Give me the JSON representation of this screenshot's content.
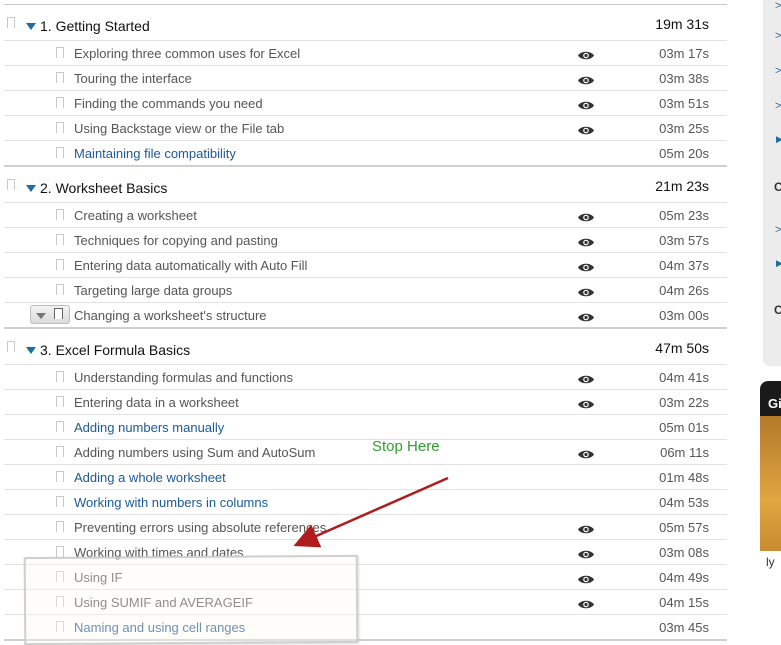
{
  "chapters": [
    {
      "title": "1. Getting Started",
      "duration": "19m 31s",
      "lessons": [
        {
          "title": "Exploring three common uses for Excel",
          "duration": "03m 17s",
          "viewed": true,
          "link": false
        },
        {
          "title": "Touring the interface",
          "duration": "03m 38s",
          "viewed": true,
          "link": false
        },
        {
          "title": "Finding the commands you need",
          "duration": "03m 51s",
          "viewed": true,
          "link": false
        },
        {
          "title": "Using Backstage view or the File tab",
          "duration": "03m 25s",
          "viewed": true,
          "link": false
        },
        {
          "title": "Maintaining file compatibility",
          "duration": "05m 20s",
          "viewed": false,
          "link": true
        }
      ]
    },
    {
      "title": "2. Worksheet Basics",
      "duration": "21m 23s",
      "lessons": [
        {
          "title": "Creating a worksheet",
          "duration": "05m 23s",
          "viewed": true,
          "link": false
        },
        {
          "title": "Techniques for copying and pasting",
          "duration": "03m 57s",
          "viewed": true,
          "link": false
        },
        {
          "title": "Entering data automatically with Auto Fill",
          "duration": "04m 37s",
          "viewed": true,
          "link": false
        },
        {
          "title": "Targeting large data groups",
          "duration": "04m 26s",
          "viewed": true,
          "link": false
        },
        {
          "title": "Changing a worksheet's structure",
          "duration": "03m 00s",
          "viewed": true,
          "link": false,
          "hovered": true
        }
      ]
    },
    {
      "title": "3. Excel Formula Basics",
      "duration": "47m 50s",
      "lessons": [
        {
          "title": "Understanding formulas and functions",
          "duration": "04m 41s",
          "viewed": true,
          "link": false
        },
        {
          "title": "Entering data in a worksheet",
          "duration": "03m 22s",
          "viewed": true,
          "link": false
        },
        {
          "title": "Adding numbers manually",
          "duration": "05m 01s",
          "viewed": false,
          "link": true
        },
        {
          "title": "Adding numbers using Sum and AutoSum",
          "duration": "06m 11s",
          "viewed": true,
          "link": false
        },
        {
          "title": "Adding a whole worksheet",
          "duration": "01m 48s",
          "viewed": false,
          "link": true
        },
        {
          "title": "Working with numbers in columns",
          "duration": "04m 53s",
          "viewed": false,
          "link": true
        },
        {
          "title": "Preventing errors using absolute references",
          "duration": "05m 57s",
          "viewed": true,
          "link": false
        },
        {
          "title": "Working with times and dates",
          "duration": "03m 08s",
          "viewed": true,
          "link": false
        },
        {
          "title": "Using IF",
          "duration": "04m 49s",
          "viewed": true,
          "link": false
        },
        {
          "title": "Using SUMIF and AVERAGEIF",
          "duration": "04m 15s",
          "viewed": true,
          "link": false
        },
        {
          "title": "Naming and using cell ranges",
          "duration": "03m 45s",
          "viewed": false,
          "link": true
        }
      ]
    }
  ],
  "annotation": {
    "text": "Stop Here",
    "color": "#2ea02e",
    "arrow_color": "#b01c1c"
  },
  "colors": {
    "link": "#1b5a96",
    "text": "#555555",
    "accent": "#1a6fa8"
  },
  "sidebar": {
    "ad_text": "Gi",
    "caption": "ly"
  }
}
